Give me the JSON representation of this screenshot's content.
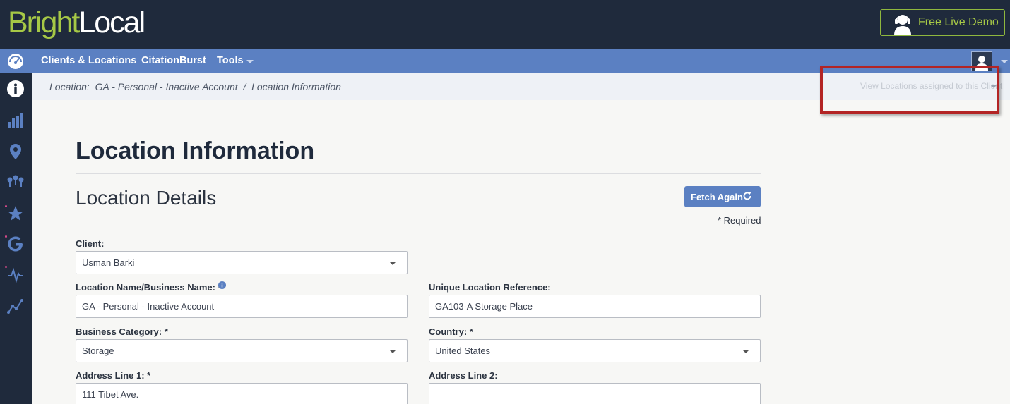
{
  "header": {
    "logo_part1": "Bright",
    "logo_part2": "Local",
    "demo_button": "Free Live Demo",
    "demo_icon": "headset-user-icon"
  },
  "nav": {
    "logo_icon": "dashboard-gauge-icon",
    "items": [
      "Clients & Locations",
      "CitationBurst",
      "Tools"
    ],
    "avatar_icon": "user-avatar-icon"
  },
  "sidebar": {
    "icons": [
      "info-icon",
      "bar-chart-icon",
      "map-pin-icon",
      "pin-network-icon",
      "star-icon",
      "google-icon",
      "pulse-icon",
      "trend-line-icon"
    ]
  },
  "breadcrumb": {
    "text": "Location:  GA - Personal - Inactive Account  /  Location Information",
    "location_selector": "View Locations assigned to this Client"
  },
  "page": {
    "title": "Location Information",
    "section_title": "Location Details",
    "fetch_button": "Fetch Again",
    "required_note": "* Required"
  },
  "form": {
    "client_label": "Client:",
    "client_value": "Usman Barki",
    "location_name_label": "Location Name/Business Name: *",
    "location_name_value": "GA - Personal - Inactive Account",
    "unique_ref_label": "Unique Location Reference:",
    "unique_ref_value": "GA103-A Storage Place",
    "business_category_label": "Business Category: *",
    "business_category_value": "Storage",
    "country_label": "Country: *",
    "country_value": "United States",
    "address1_label": "Address Line 1: *",
    "address1_value": "111 Tibet Ave.",
    "address2_label": "Address Line 2:",
    "address2_value": ""
  },
  "colors": {
    "header_bg": "#1f2a3c",
    "nav_bg": "#5b80c2",
    "brand_green": "#a6c846",
    "highlight_red": "#b32424"
  }
}
